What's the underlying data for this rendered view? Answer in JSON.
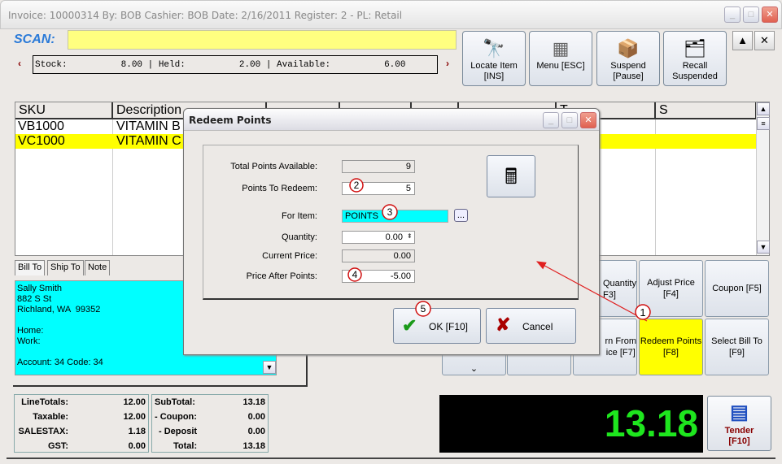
{
  "window": {
    "title": "Invoice: 10000314  By: BOB  Cashier: BOB   Date:  2/16/2011  Register: 2 - PL: Retail",
    "minimize": "_",
    "maximize": "□",
    "close": "✕"
  },
  "scan": {
    "label": "SCAN:",
    "value": ""
  },
  "stock_bar": {
    "text": "Stock:          8.00 | Held:          2.00 | Available:          6.00",
    "prev": "‹",
    "next": "›"
  },
  "toolbar": [
    {
      "label": "Locate Item\n[INS]",
      "icon": "binoculars-icon",
      "glyph": "⛶"
    },
    {
      "label": "Menu [ESC]",
      "icon": "menu-grid-icon",
      "glyph": "▦"
    },
    {
      "label": "Suspend\n[Pause]",
      "icon": "box-icon",
      "glyph": "📦"
    },
    {
      "label": "Recall\nSuspended",
      "icon": "recall-icon",
      "glyph": "🗂"
    }
  ],
  "small_buttons": {
    "up": "▲",
    "close": "✕"
  },
  "grid": {
    "headers": [
      "SKU",
      "Description",
      "",
      "",
      "",
      "",
      "T",
      "S"
    ],
    "rows": [
      {
        "sku": "VB1000",
        "description": "VITAMIN B",
        "selected": false
      },
      {
        "sku": "VC1000",
        "description": "VITAMIN C",
        "selected": true
      }
    ]
  },
  "tabs": [
    "Bill To",
    "Ship To",
    "Note"
  ],
  "bill_to": "Sally Smith\n882 S St\nRichland, WA  99352\n\nHome:\nWork:\n\nAccount: 34 Code: 34",
  "function_buttons": {
    "quantity": "Quantity\nF3]",
    "adjust_price": "Adjust Price [F4]",
    "coupon": "Coupon [F5]",
    "return": "rn From\nice [F7]",
    "redeem": "Redeem Points\n[F8]",
    "select_bill": "Select Bill To\n[F9]",
    "more": "⌄"
  },
  "totals_left": [
    {
      "label": "LineTotals:",
      "value": "12.00"
    },
    {
      "label": "Taxable:",
      "value": "12.00"
    },
    {
      "label": "SALESTAX:",
      "value": "1.18"
    },
    {
      "label": "GST:",
      "value": "0.00"
    }
  ],
  "totals_right": [
    {
      "label": "SubTotal:",
      "value": "13.18"
    },
    {
      "label": "- Coupon:",
      "value": "0.00"
    },
    {
      "label": "- Deposit",
      "value": "0.00"
    },
    {
      "label": "Total:",
      "value": "13.18"
    }
  ],
  "display_total": "13.18",
  "tender": {
    "label": "Tender",
    "key": "[F10]"
  },
  "dialog": {
    "title": "Redeem Points",
    "fields": {
      "total_points_label": "Total Points Available:",
      "total_points": "9",
      "points_to_redeem_label": "Points To Redeem:",
      "points_to_redeem": "5",
      "for_item_label": "For Item:",
      "for_item": "POINTS",
      "browse": "...",
      "quantity_label": "Quantity:",
      "quantity": "0.00",
      "current_price_label": "Current Price:",
      "current_price": "0.00",
      "price_after_label": "Price After Points:",
      "price_after": "-5.00"
    },
    "ok": "OK [F10]",
    "cancel": "Cancel"
  },
  "annotations": [
    "1",
    "2",
    "3",
    "4",
    "5"
  ],
  "colors": {
    "highlight": "#ffff00",
    "cyan": "#00ffff",
    "display_text": "#1ee61e",
    "annotation": "#e02020"
  }
}
